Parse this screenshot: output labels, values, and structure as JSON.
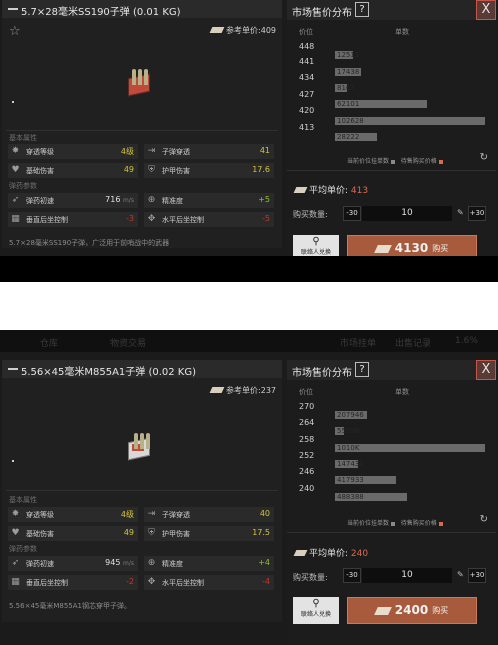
{
  "panels": [
    {
      "title": "5.7×28毫米SS190子弹 (0.01 KG)",
      "ref_price_label": "参考单价:409",
      "section_basic": "基本属性",
      "section_ballistic": "弹药参数",
      "stats": [
        {
          "label": "穿透等级",
          "value": "4级",
          "color": "yellow",
          "icon": "penetration-icon"
        },
        {
          "label": "子弹穿透",
          "value": "41",
          "color": "yellow",
          "icon": "bullet-pen-icon"
        },
        {
          "label": "基础伤害",
          "value": "49",
          "color": "yellow",
          "icon": "damage-icon"
        },
        {
          "label": "护甲伤害",
          "value": "17.6",
          "color": "yellow",
          "icon": "armor-damage-icon"
        },
        {
          "label": "弹药初速",
          "value": "716",
          "unit": "m/s",
          "color": "white",
          "icon": "velocity-icon"
        },
        {
          "label": "精准度",
          "value": "+5",
          "color": "green",
          "icon": "accuracy-icon"
        },
        {
          "label": "垂直后坐控制",
          "value": "-3",
          "color": "red",
          "icon": "v-recoil-icon"
        },
        {
          "label": "水平后坐控制",
          "value": "-5",
          "color": "red",
          "icon": "h-recoil-icon"
        }
      ],
      "description": "5.7×28毫米SS190子弹，广泛用于前哨战中的武器",
      "market_title": "市场售价分布",
      "help": "?",
      "close": "X",
      "col_price": "价位",
      "col_qty": "单数",
      "price_rows": [
        {
          "price": "448",
          "qty": "",
          "fill": 0.0
        },
        {
          "price": "441",
          "qty": "12512",
          "fill": 0.12
        },
        {
          "price": "434",
          "qty": "17438",
          "fill": 0.17
        },
        {
          "price": "427",
          "qty": "8167",
          "fill": 0.08
        },
        {
          "price": "420",
          "qty": "62101",
          "fill": 0.61
        },
        {
          "price": "413",
          "qty": "102628",
          "fill": 1.0
        },
        {
          "price": "",
          "qty": "28222",
          "fill": 0.28
        }
      ],
      "legend_current": "当前价位挂单数",
      "legend_wait": "待售购买价格",
      "avg_label": "平均单价:",
      "avg_value": "413",
      "qty_label": "购买数量:",
      "minus": "-30",
      "qty": "10",
      "plus": "+30",
      "seller_label": "联络人兑换",
      "buy_price": "4130",
      "buy_label": "购买",
      "colors": {
        "accent": "#a85a3c",
        "avg": "#d86b4e"
      }
    },
    {
      "title": "5.56×45毫米M855A1子弹 (0.02 KG)",
      "ref_price_label": "参考单价:237",
      "section_basic": "基本属性",
      "section_ballistic": "弹药参数",
      "stats": [
        {
          "label": "穿透等级",
          "value": "4级",
          "color": "yellow",
          "icon": "penetration-icon"
        },
        {
          "label": "子弹穿透",
          "value": "40",
          "color": "yellow",
          "icon": "bullet-pen-icon"
        },
        {
          "label": "基础伤害",
          "value": "49",
          "color": "yellow",
          "icon": "damage-icon"
        },
        {
          "label": "护甲伤害",
          "value": "17.5",
          "color": "yellow",
          "icon": "armor-damage-icon"
        },
        {
          "label": "弹药初速",
          "value": "945",
          "unit": "m/s",
          "color": "white",
          "icon": "velocity-icon"
        },
        {
          "label": "精准度",
          "value": "+4",
          "color": "green",
          "icon": "accuracy-icon"
        },
        {
          "label": "垂直后坐控制",
          "value": "-2",
          "color": "red",
          "icon": "v-recoil-icon"
        },
        {
          "label": "水平后坐控制",
          "value": "-4",
          "color": "red",
          "icon": "h-recoil-icon"
        }
      ],
      "description": "5.56×45毫米M855A1钢芯穿甲子弹。",
      "market_title": "市场售价分布",
      "help": "?",
      "close": "X",
      "col_price": "价位",
      "col_qty": "单数",
      "price_rows": [
        {
          "price": "270",
          "qty": "",
          "fill": 0.0
        },
        {
          "price": "264",
          "qty": "207946",
          "fill": 0.21
        },
        {
          "price": "258",
          "qty": "55598",
          "fill": 0.06
        },
        {
          "price": "252",
          "qty": "1010K",
          "fill": 1.0
        },
        {
          "price": "246",
          "qty": "147431",
          "fill": 0.15
        },
        {
          "price": "240",
          "qty": "417933",
          "fill": 0.41
        },
        {
          "price": "",
          "qty": "488388",
          "fill": 0.48
        }
      ],
      "legend_current": "当前价位挂单数",
      "legend_wait": "待售购买价格",
      "avg_label": "平均单价:",
      "avg_value": "240",
      "qty_label": "购买数量:",
      "minus": "-30",
      "qty": "10",
      "plus": "+30",
      "seller_label": "联络人兑换",
      "buy_price": "2400",
      "buy_label": "购买",
      "colors": {
        "accent": "#a85a3c",
        "avg": "#d86b4e"
      }
    }
  ],
  "top_strip": [
    "仓库",
    "物资交易",
    "市场挂单",
    "出售记录",
    "1.6%"
  ]
}
